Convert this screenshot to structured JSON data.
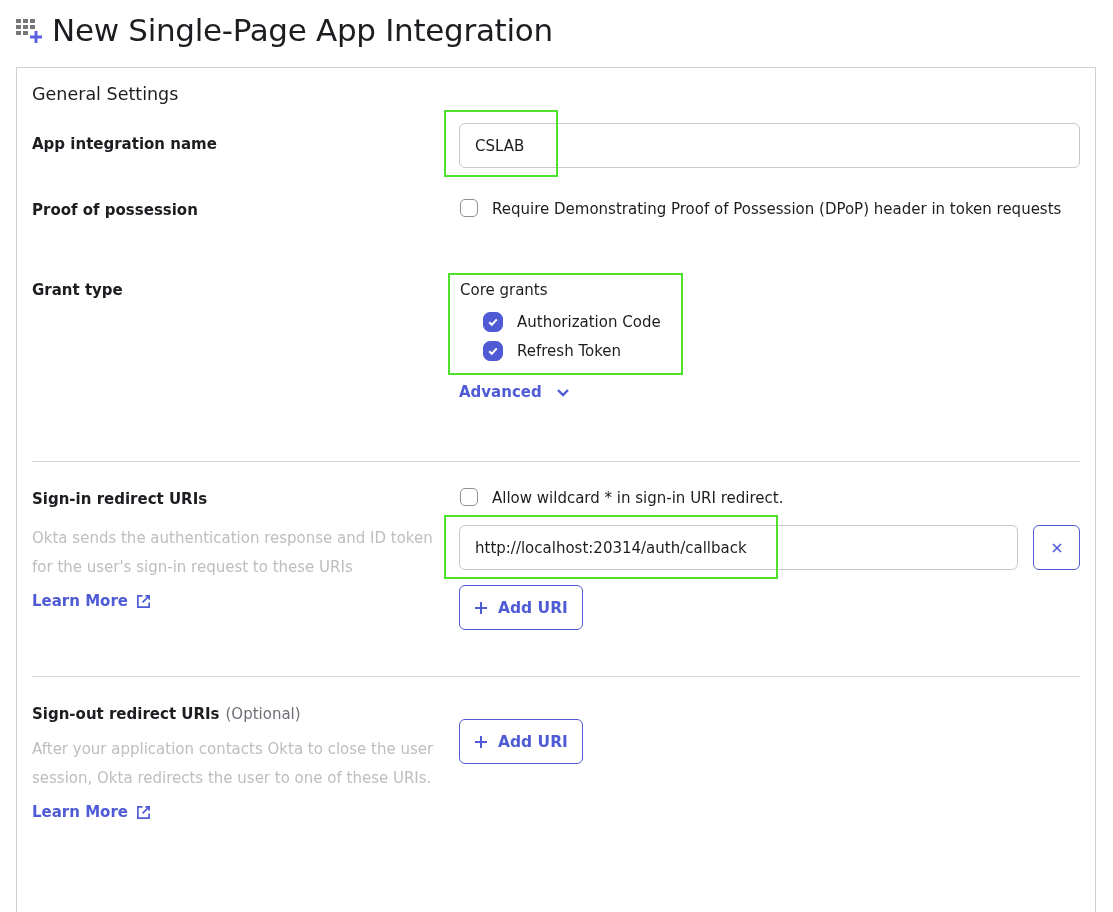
{
  "page": {
    "title": "New Single-Page App Integration"
  },
  "general_settings": {
    "heading": "General Settings",
    "app_name": {
      "label": "App integration name",
      "value": "CSLAB",
      "highlighted": true
    },
    "proof_of_possession": {
      "label": "Proof of possession",
      "checkbox": {
        "label": "Require Demonstrating Proof of Possession (DPoP) header in token requests",
        "checked": false
      }
    },
    "grant_type": {
      "label": "Grant type",
      "group_label": "Core grants",
      "highlighted": true,
      "grants": [
        {
          "label": "Authorization Code",
          "checked": true
        },
        {
          "label": "Refresh Token",
          "checked": true
        }
      ],
      "advanced_link": "Advanced"
    }
  },
  "sign_in_redirect": {
    "label": "Sign-in redirect URIs",
    "description": "Okta sends the authentication response and ID token for the user's sign-in request to these URIs",
    "learn_more": "Learn More",
    "wildcard": {
      "label": "Allow wildcard * in sign-in URI redirect.",
      "checked": false
    },
    "uris": [
      {
        "value": "http://localhost:20314/auth/callback",
        "highlighted": true
      }
    ],
    "add_button": "Add URI"
  },
  "sign_out_redirect": {
    "label": "Sign-out redirect URIs",
    "optional_tag": "(Optional)",
    "description": "After your application contacts Okta to close the user session, Okta redirects the user to one of these URIs.",
    "learn_more": "Learn More",
    "add_button": "Add URI"
  }
}
